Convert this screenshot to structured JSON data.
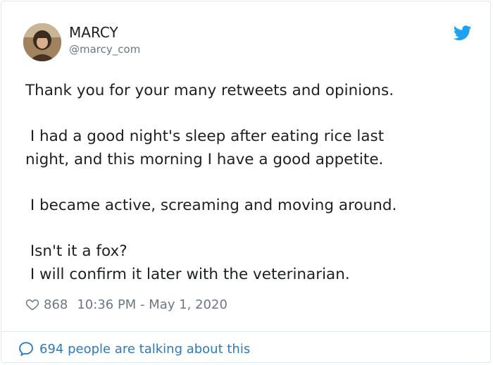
{
  "author": {
    "display_name": "MARCY",
    "handle": "@marcy_com"
  },
  "tweet": {
    "paragraphs": [
      [
        "Thank you for your many retweets and opinions."
      ],
      [
        " I had a good night's sleep after eating rice last",
        "night, and this morning I have a good appetite."
      ],
      [
        " I became active, screaming and moving around."
      ],
      [
        " Isn't it a fox?",
        " I will confirm it later with the veterinarian."
      ]
    ]
  },
  "meta": {
    "like_count": "868",
    "timestamp": "10:36 PM - May 1, 2020"
  },
  "conversation": {
    "label": "694 people are talking about this"
  },
  "icons": {
    "logo": "twitter-bird-icon",
    "like": "heart-icon",
    "conversation": "speech-bubble-icon"
  },
  "colors": {
    "brand_blue": "#1da1f2",
    "link_blue": "#2b7bb9",
    "secondary_text": "#697882",
    "primary_text": "#1c2022",
    "border": "#e1e8ed"
  }
}
